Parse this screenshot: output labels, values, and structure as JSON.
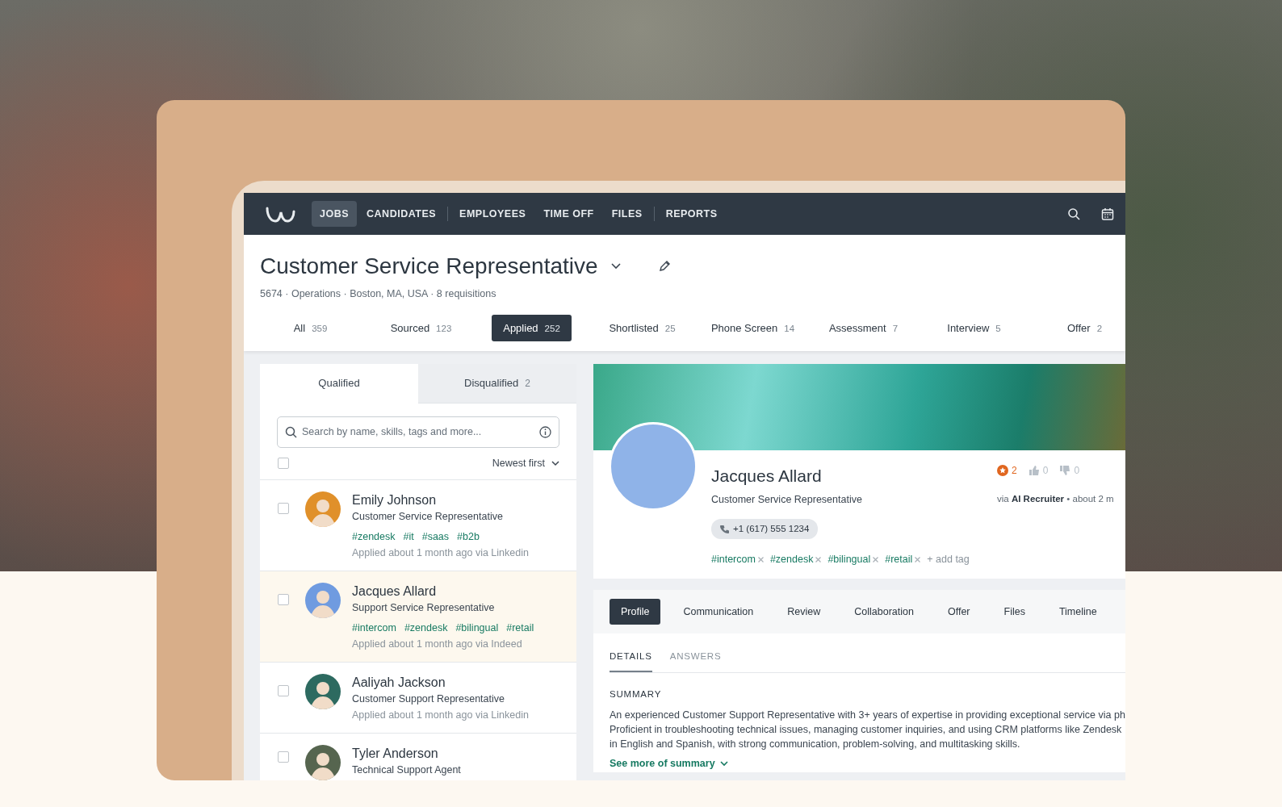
{
  "nav": {
    "items": [
      {
        "label": "JOBS",
        "selected": true
      },
      {
        "label": "CANDIDATES",
        "selected": false
      },
      {
        "label": "EMPLOYEES",
        "selected": false
      },
      {
        "label": "TIME OFF",
        "selected": false
      },
      {
        "label": "FILES",
        "selected": false
      },
      {
        "label": "REPORTS",
        "selected": false
      }
    ]
  },
  "job": {
    "title": "Customer Service Representative",
    "meta": "5674 · Operations · Boston, MA, USA · 8 requisitions"
  },
  "stages": [
    {
      "label": "All",
      "count": "359",
      "selected": false
    },
    {
      "label": "Sourced",
      "count": "123",
      "selected": false
    },
    {
      "label": "Applied",
      "count": "252",
      "selected": true
    },
    {
      "label": "Shortlisted",
      "count": "25",
      "selected": false
    },
    {
      "label": "Phone Screen",
      "count": "14",
      "selected": false
    },
    {
      "label": "Assessment",
      "count": "7",
      "selected": false
    },
    {
      "label": "Interview",
      "count": "5",
      "selected": false
    },
    {
      "label": "Offer",
      "count": "2",
      "selected": false
    }
  ],
  "list_tabs": [
    {
      "label": "Qualified",
      "selected": true
    },
    {
      "label": "Disqualified",
      "count": "2",
      "selected": false
    }
  ],
  "search": {
    "placeholder": "Search by name, skills, tags and more..."
  },
  "sort": {
    "label": "Newest first",
    "select_all_checked": false
  },
  "candidates": [
    {
      "name": "Emily Johnson",
      "title": "Customer Service Representative",
      "tags": [
        "#zendesk",
        "#it",
        "#saas",
        "#b2b"
      ],
      "applied": "Applied about 1 month ago via Linkedin",
      "selected": false,
      "checked": false
    },
    {
      "name": "Jacques Allard",
      "title": "Support Service Representative",
      "tags": [
        "#intercom",
        "#zendesk",
        "#bilingual",
        "#retail"
      ],
      "applied": "Applied about 1 month ago via Indeed",
      "selected": true,
      "checked": false
    },
    {
      "name": "Aaliyah Jackson",
      "title": "Customer Support Representative",
      "applied": "Applied about 1 month ago via Linkedin",
      "selected": false,
      "checked": false
    },
    {
      "name": "Tyler Anderson",
      "title": "Technical Support Agent",
      "selected": false,
      "checked": false
    }
  ],
  "profile": {
    "name": "Jacques Allard",
    "title": "Customer Service Representative",
    "phone": "+1 (617) 555 1234",
    "ratings": [
      {
        "kind": "star",
        "count": "2"
      },
      {
        "kind": "thumbs-up",
        "count": "0"
      },
      {
        "kind": "thumbs-down",
        "count": "0"
      }
    ],
    "source": "via **AI Recruiter** • about 2 m",
    "tags": [
      "#intercom",
      "#zendesk",
      "#bilingual",
      "#retail"
    ],
    "add_tag": "+ add tag"
  },
  "profile_tabs": [
    {
      "label": "Profile",
      "selected": true
    },
    {
      "label": "Communication",
      "selected": false
    },
    {
      "label": "Review",
      "selected": false
    },
    {
      "label": "Collaboration",
      "selected": false
    },
    {
      "label": "Offer",
      "selected": false
    },
    {
      "label": "Files",
      "selected": false
    },
    {
      "label": "Timeline",
      "selected": false
    }
  ],
  "detail_tabs": [
    {
      "label": "DETAILS",
      "selected": true
    },
    {
      "label": "ANSWERS",
      "selected": false
    }
  ],
  "summary": {
    "heading": "SUMMARY",
    "lines": [
      "An experienced Customer Support Representative with 3+ years of expertise in providing exceptional service via ph",
      "Proficient in troubleshooting technical issues, managing customer inquiries, and using CRM platforms like Zendesk",
      "in English and Spanish, with strong communication, problem-solving, and multitasking skills."
    ],
    "more": "See more of summary"
  }
}
